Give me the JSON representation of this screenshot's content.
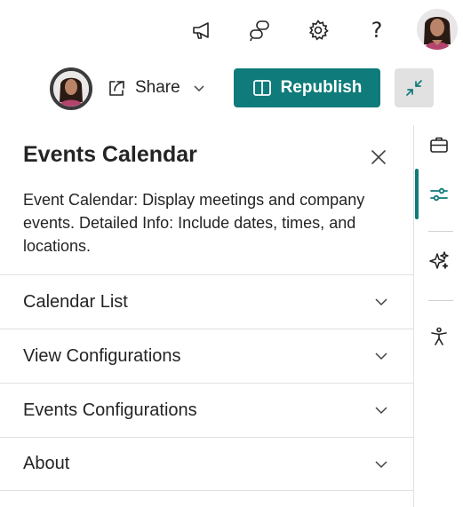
{
  "topbar": {
    "icons": [
      "megaphone-icon",
      "chat-bubbles-icon",
      "gear-icon",
      "help-icon"
    ],
    "help_label": "?"
  },
  "actionbar": {
    "share_label": "Share",
    "republish_label": "Republish"
  },
  "panel": {
    "title": "Events Calendar",
    "description": "Event Calendar: Display meetings and company events. Detailed Info: Include dates, times, and locations.",
    "sections": [
      {
        "label": "Calendar List"
      },
      {
        "label": "View Configurations"
      },
      {
        "label": "Events Configurations"
      },
      {
        "label": "About"
      }
    ]
  },
  "rail": {
    "items": [
      "briefcase-icon",
      "sliders-icon",
      "sparkle-icon",
      "accessibility-icon"
    ],
    "active": "sliders-icon"
  },
  "colors": {
    "accent": "#0f7b7a",
    "collapse_bg": "#e1e1e1",
    "text": "#242424"
  }
}
